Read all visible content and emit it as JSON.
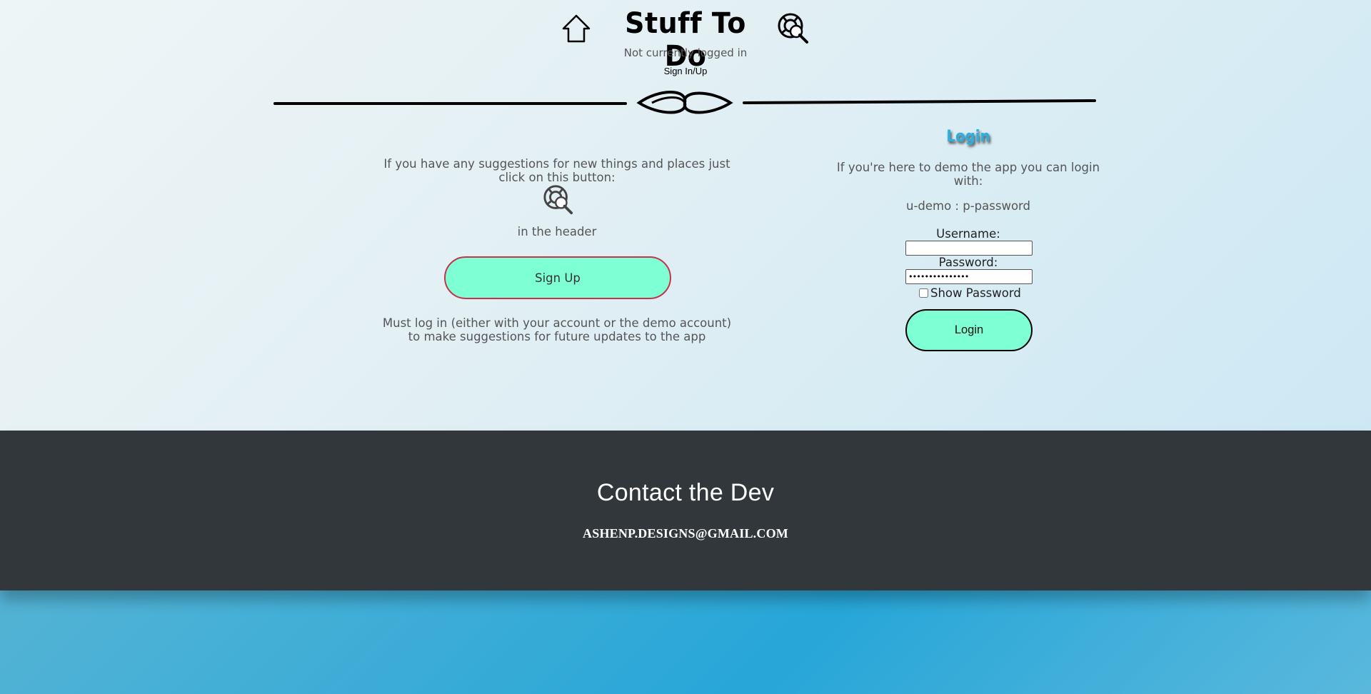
{
  "header": {
    "title": "Stuff To Do",
    "login_status": "Not currently logged in",
    "signin_link": "Sign In/Up",
    "home_icon": "home-icon",
    "suggest_icon": "lifebuoy-magnifier-icon"
  },
  "suggestions": {
    "intro_text": "If you have any suggestions for new things and places just click on this button:",
    "icon": "lifebuoy-magnifier-icon",
    "location_text": "in the header",
    "signup_label": "Sign Up",
    "requirement_text": "Must log in (either with your account or the demo account) to make suggestions for future updates to the app"
  },
  "login": {
    "heading": "Login",
    "demo_text": "If you're here to demo the app you can login with:",
    "demo_credentials": "u-demo : p-password",
    "username_label": "Username:",
    "username_value": "",
    "password_label": "Password:",
    "password_value": "•••••••••••••••",
    "show_password_label": "Show Password",
    "show_password_checked": false,
    "login_label": "Login"
  },
  "footer": {
    "title": "Contact the Dev",
    "email": "ashenp.designs@gmail.com"
  },
  "colors": {
    "button_fill": "#7fffd4",
    "signup_border": "#c4354d",
    "login_heading": "#2ab0e0",
    "footer_bg": "#31373a"
  }
}
